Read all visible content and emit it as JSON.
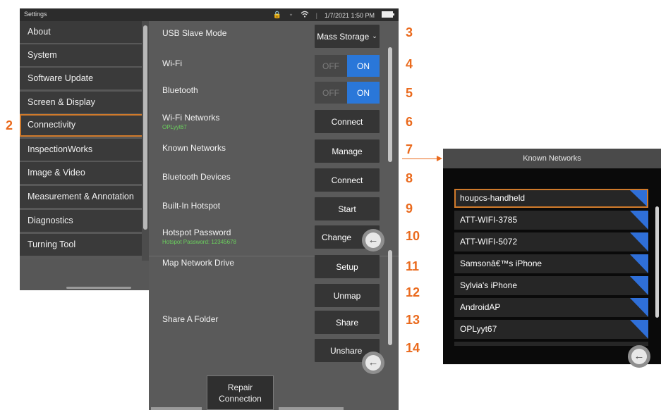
{
  "statusbar": {
    "title": "Settings",
    "datetime": "1/7/2021 1:50 PM"
  },
  "menu": {
    "items": [
      {
        "label": "About"
      },
      {
        "label": "System"
      },
      {
        "label": "Software Update"
      },
      {
        "label": "Screen & Display"
      },
      {
        "label": "Connectivity"
      },
      {
        "label": "InspectionWorks"
      },
      {
        "label": "Image & Video"
      },
      {
        "label": "Measurement & Annotation"
      },
      {
        "label": "Diagnostics"
      },
      {
        "label": "Turning Tool"
      }
    ],
    "selected": "Connectivity"
  },
  "connectivity": {
    "usb_slave_mode": {
      "label": "USB Slave Mode",
      "value": "Mass Storage"
    },
    "wifi": {
      "label": "Wi-Fi",
      "off": "OFF",
      "on": "ON",
      "state": "on"
    },
    "bluetooth": {
      "label": "Bluetooth",
      "off": "OFF",
      "on": "ON",
      "state": "on"
    },
    "wifi_networks": {
      "label": "Wi-Fi Networks",
      "sub": "OPLyyt67",
      "button": "Connect"
    },
    "known_networks": {
      "label": "Known Networks",
      "button": "Manage"
    },
    "bluetooth_devices": {
      "label": "Bluetooth Devices",
      "button": "Connect"
    },
    "hotspot": {
      "label": "Built-In Hotspot",
      "button": "Start"
    },
    "hotspot_password": {
      "label": "Hotspot Password",
      "sub": "Hotspot Password: 12345678",
      "button": "Change"
    },
    "map_drive": {
      "label": "Map Network Drive",
      "setup": "Setup",
      "unmap": "Unmap"
    },
    "share_folder": {
      "label": "Share A Folder",
      "share": "Share",
      "unshare": "Unshare"
    },
    "repair": {
      "line1": "Repair",
      "line2": "Connection"
    }
  },
  "callouts": {
    "n2": "2",
    "n3": "3",
    "n4": "4",
    "n5": "5",
    "n6": "6",
    "n7": "7",
    "n8": "8",
    "n9": "9",
    "n10": "10",
    "n11": "11",
    "n12": "12",
    "n13": "13",
    "n14": "14"
  },
  "known_networks_panel": {
    "title": "Known Networks",
    "networks": [
      {
        "name": "houpcs-handheld"
      },
      {
        "name": "ATT-WIFI-3785"
      },
      {
        "name": "ATT-WIFI-5072"
      },
      {
        "name": "Samsonâ€™s iPhone"
      },
      {
        "name": "Sylvia's iPhone"
      },
      {
        "name": "AndroidAP"
      },
      {
        "name": "OPLyyt67"
      }
    ]
  },
  "colors": {
    "accent_orange": "#ea6a1d",
    "toggle_on": "#2a77d9",
    "selected_border": "#d07a2b"
  },
  "icons": [
    "lock-icon",
    "bluetooth-icon",
    "wifi-icon",
    "battery-icon",
    "back-arrow-icon",
    "chevron-down-icon"
  ]
}
